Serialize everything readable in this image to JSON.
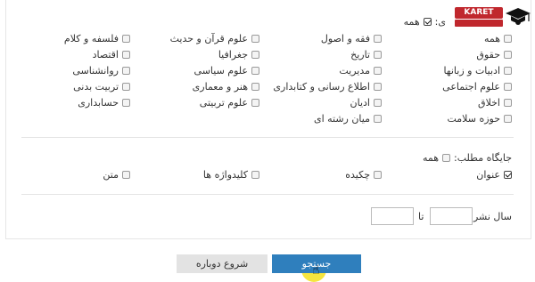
{
  "logo": {
    "brand": "KARET"
  },
  "subjects": {
    "header_all": "همه",
    "header_suffix": "ی:",
    "items": [
      {
        "label": "همه",
        "checked": false
      },
      {
        "label": "فقه و اصول",
        "checked": false
      },
      {
        "label": "علوم قرآن و حدیث",
        "checked": false
      },
      {
        "label": "فلسفه و کلام",
        "checked": false
      },
      {
        "label": "حقوق",
        "checked": false
      },
      {
        "label": "تاریخ",
        "checked": false
      },
      {
        "label": "جغرافیا",
        "checked": false
      },
      {
        "label": "اقتصاد",
        "checked": false
      },
      {
        "label": "ادبیات و زبانها",
        "checked": false
      },
      {
        "label": "مدیریت",
        "checked": false
      },
      {
        "label": "علوم سیاسی",
        "checked": false
      },
      {
        "label": "روانشناسی",
        "checked": false
      },
      {
        "label": "علوم اجتماعی",
        "checked": false
      },
      {
        "label": "اطلاع رسانی و کتابداری",
        "checked": false
      },
      {
        "label": "هنر و معماری",
        "checked": false
      },
      {
        "label": "تربیت بدنی",
        "checked": false
      },
      {
        "label": "اخلاق",
        "checked": false
      },
      {
        "label": "ادیان",
        "checked": false
      },
      {
        "label": "علوم تربیتی",
        "checked": false
      },
      {
        "label": "حسابداری",
        "checked": false
      },
      {
        "label": "حوزه سلامت",
        "checked": false
      },
      {
        "label": "میان رشته ای",
        "checked": false
      }
    ]
  },
  "position": {
    "label": "جایگاه مطلب:",
    "all_label": "همه",
    "options": [
      {
        "label": "عنوان",
        "checked": true
      },
      {
        "label": "چکیده",
        "checked": false
      },
      {
        "label": "کلیدواژه ها",
        "checked": false
      },
      {
        "label": "متن",
        "checked": false
      }
    ]
  },
  "year": {
    "label": "سال نشر از:",
    "to_label": "تا",
    "from_value": "",
    "to_value": ""
  },
  "buttons": {
    "search": "جستجو",
    "reset": "شروع دوباره"
  }
}
